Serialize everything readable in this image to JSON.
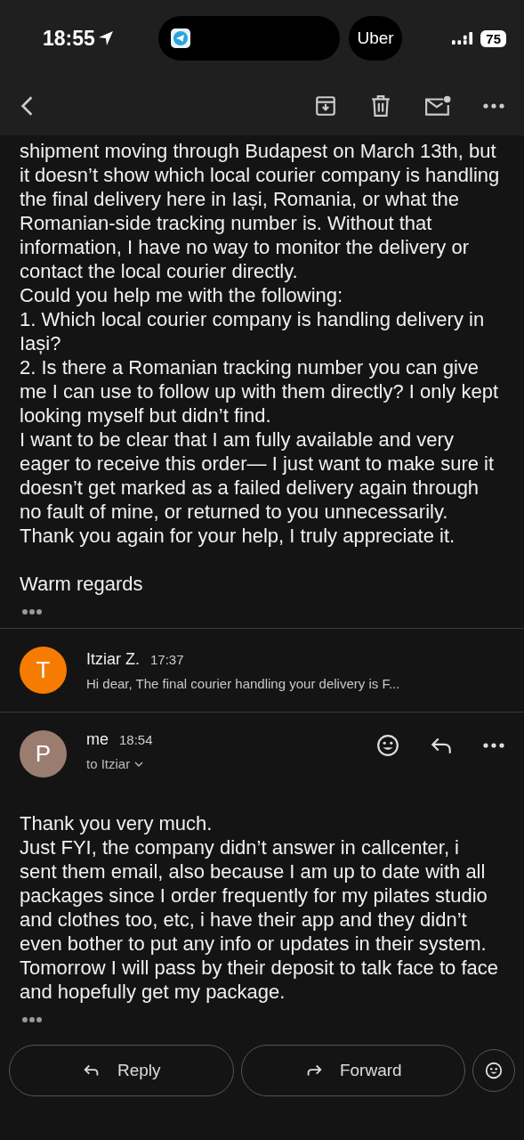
{
  "status_bar": {
    "time": "18:55",
    "pill_app": "Uber",
    "battery": "75"
  },
  "messages": [
    {
      "kind": "body",
      "paragraphs": [
        "shipment moving through Budapest on March 13th, but it doesn’t show which local courier company is handling the final delivery here in Iași, Romania, or what the Romanian-side tracking number is. Without that information, I have no way to monitor the delivery or contact the local courier directly.",
        "Could you help me with the following:",
        "1. Which local courier company is handling delivery in Iași?",
        "2. Is there a Romanian tracking number you can give me I can use to follow up with them directly? I only kept looking myself but didn’t find.",
        "I want to be clear that I am fully available and very eager to receive this order— I just want to make sure it doesn’t get marked as a failed delivery again through no fault of mine, or returned to you unnecessarily.",
        "Thank you again for your help, I truly appreciate it."
      ],
      "signoff": "Warm regards"
    },
    {
      "kind": "collapsed",
      "initial": "T",
      "color": "#f57c00",
      "sender": "Itziar Z.",
      "time": "17:37",
      "snippet": "Hi dear, The final courier handling your delivery is F..."
    },
    {
      "kind": "expanded",
      "initial": "P",
      "color": "#9b7d70",
      "sender": "me",
      "time": "18:54",
      "recipient": "to Itziar",
      "paragraphs": [
        "Thank you very much.",
        "Just FYI, the company didn’t answer in callcenter, i sent them email, also because I am up to date with all packages since I order frequently for my pilates studio and clothes too, etc, i have their app and they didn’t even bother to put any info or updates in their system. Tomorrow I will pass by their deposit to talk face to face and hopefully get my package."
      ]
    }
  ],
  "actions": [
    {
      "kind": "reply",
      "label": "Reply"
    },
    {
      "kind": "forward",
      "label": "Forward"
    }
  ]
}
